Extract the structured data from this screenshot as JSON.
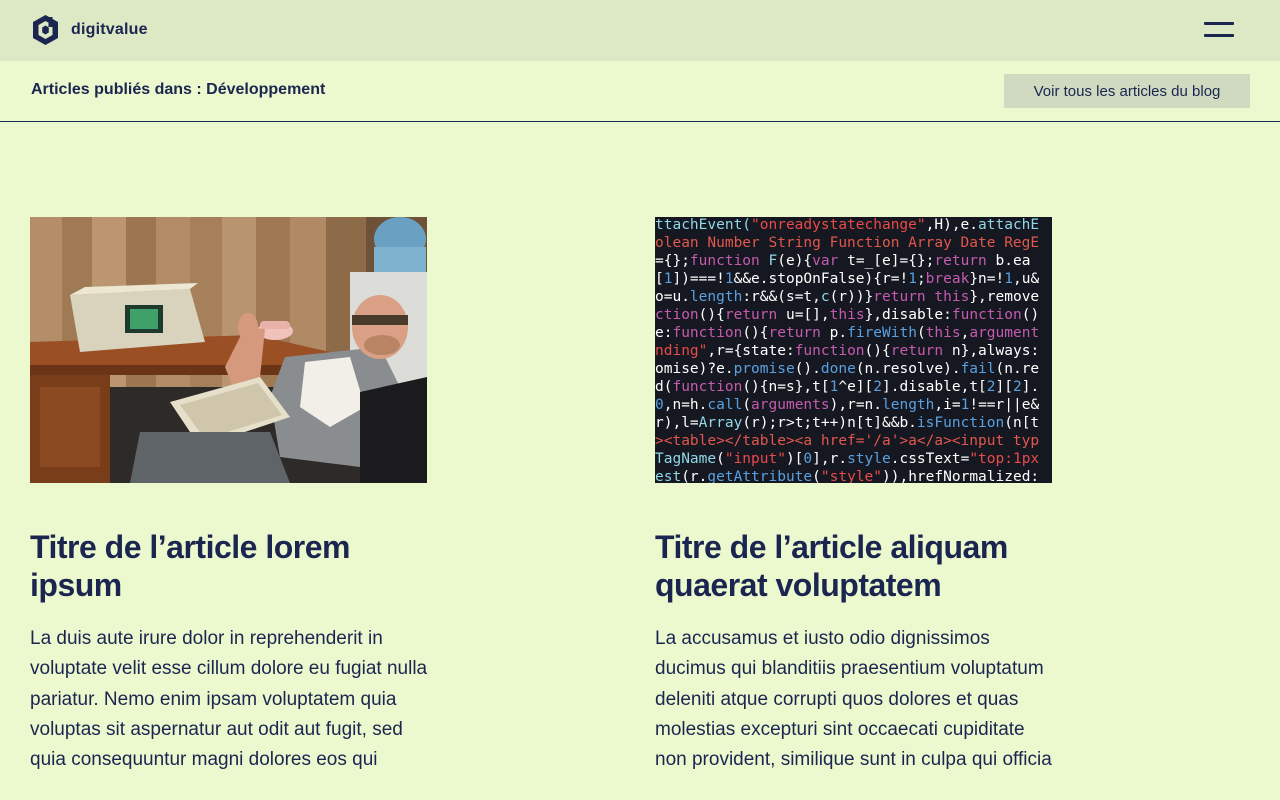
{
  "header": {
    "brand": "digitvalue",
    "menu_icon": "hamburger-menu-icon"
  },
  "subheader": {
    "title": "Articles publiés dans : Développement",
    "all_articles_label": "Voir tous les articles du blog"
  },
  "articles": [
    {
      "title": "Titre de l’article lorem ipsum",
      "excerpt": "La duis aute irure dolor in reprehenderit in voluptate velit esse cillum dolore eu fugiat nulla pariatur. Nemo enim ipsam voluptatem quia voluptas sit aspernatur aut odit aut fugit, sed quia consequuntur magni dolores eos qui"
    },
    {
      "title": "Titre de l’article aliquam quaerat voluptatem",
      "excerpt": "La accusamus et iusto odio dignissimos ducimus qui blanditiis praesentium voluptatum deleniti atque corrupti quos dolores et quas molestias excepturi sint occaecati cupiditate non provident, similique sunt in culpa qui officia"
    }
  ],
  "colors": {
    "page_bg": "#ecf8ce",
    "topbar_bg": "#dde8c4",
    "button_bg": "#cfdac1",
    "text_navy": "#1b2650"
  }
}
